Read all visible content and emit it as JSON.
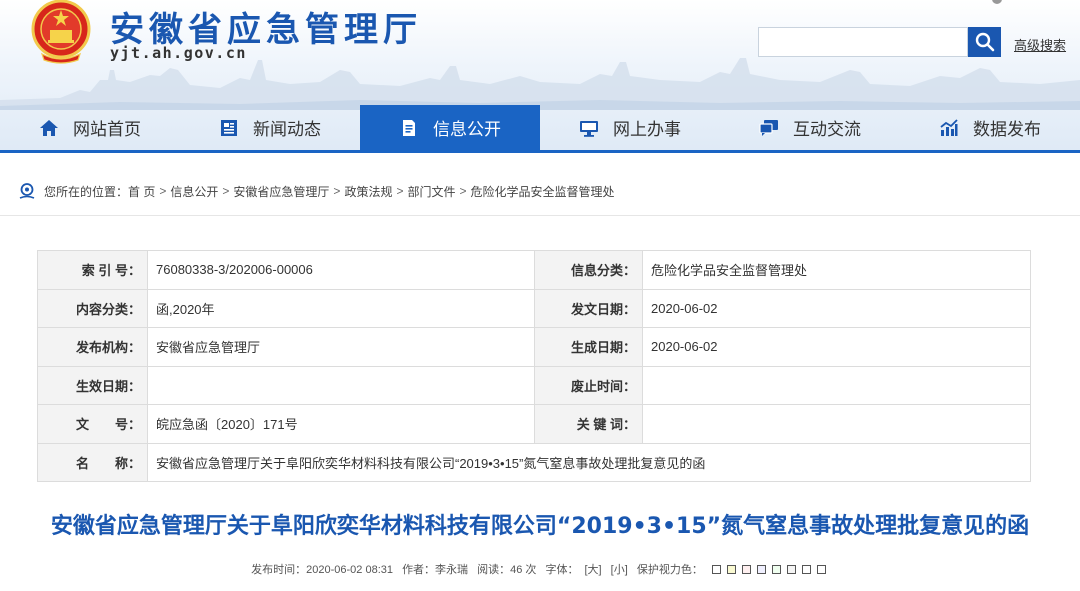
{
  "header": {
    "site_title": "安徽省应急管理厅",
    "site_domain": "yjt.ah.gov.cn",
    "search_placeholder": "",
    "advanced_search": "高级搜索"
  },
  "nav": {
    "items": [
      {
        "label": "网站首页",
        "icon": "home-icon"
      },
      {
        "label": "新闻动态",
        "icon": "newspaper-icon"
      },
      {
        "label": "信息公开",
        "icon": "document-icon",
        "active": true
      },
      {
        "label": "网上办事",
        "icon": "monitor-icon"
      },
      {
        "label": "互动交流",
        "icon": "chat-icon"
      },
      {
        "label": "数据发布",
        "icon": "bar-chart-icon"
      }
    ]
  },
  "breadcrumb": {
    "prefix": "您所在的位置：",
    "items": [
      "首 页",
      "信息公开",
      "安徽省应急管理厅",
      "政策法规",
      "部门文件",
      "危险化学品安全监督管理处"
    ],
    "separator": ">"
  },
  "info": {
    "rows": [
      {
        "l1": "索 引 号：",
        "v1": "76080338-3/202006-00006",
        "l2": "信息分类：",
        "v2": "危险化学品安全监督管理处"
      },
      {
        "l1": "内容分类：",
        "v1": "函,2020年",
        "l2": "发文日期：",
        "v2": "2020-06-02"
      },
      {
        "l1": "发布机构：",
        "v1": "安徽省应急管理厅",
        "l2": "生成日期：",
        "v2": "2020-06-02"
      },
      {
        "l1": "生效日期：",
        "v1": "",
        "l2": "废止时间：",
        "v2": ""
      },
      {
        "l1": "文　　号：",
        "v1": "皖应急函〔2020〕171号",
        "l2": "关 键 词：",
        "v2": ""
      }
    ],
    "name_label": "名　　称：",
    "name_value": "安徽省应急管理厅关于阜阳欣奕华材料科技有限公司“2019•3•15”氮气窒息事故处理批复意见的函"
  },
  "article": {
    "title": "安徽省应急管理厅关于阜阳欣奕华材料科技有限公司“2019•3•15”氮气窒息事故处理批复意见的函",
    "publish": "发布时间：2020-06-02 08:31",
    "author": "作者：李永瑞",
    "views": "阅读：46 次",
    "font_size_label": "字体：",
    "font_large": "[大]",
    "font_small": "[小]",
    "eye_protect_label": "保护视力色："
  },
  "colors": {
    "brand_blue": "#1a57b0",
    "nav_active": "#1a64c4",
    "eye_swatches": [
      "#ffffff",
      "#fafad2",
      "#fff0f0",
      "#f0f0ff",
      "#f0fff0",
      "#f5f5f5",
      "#ffffff",
      "#ffffff"
    ]
  }
}
